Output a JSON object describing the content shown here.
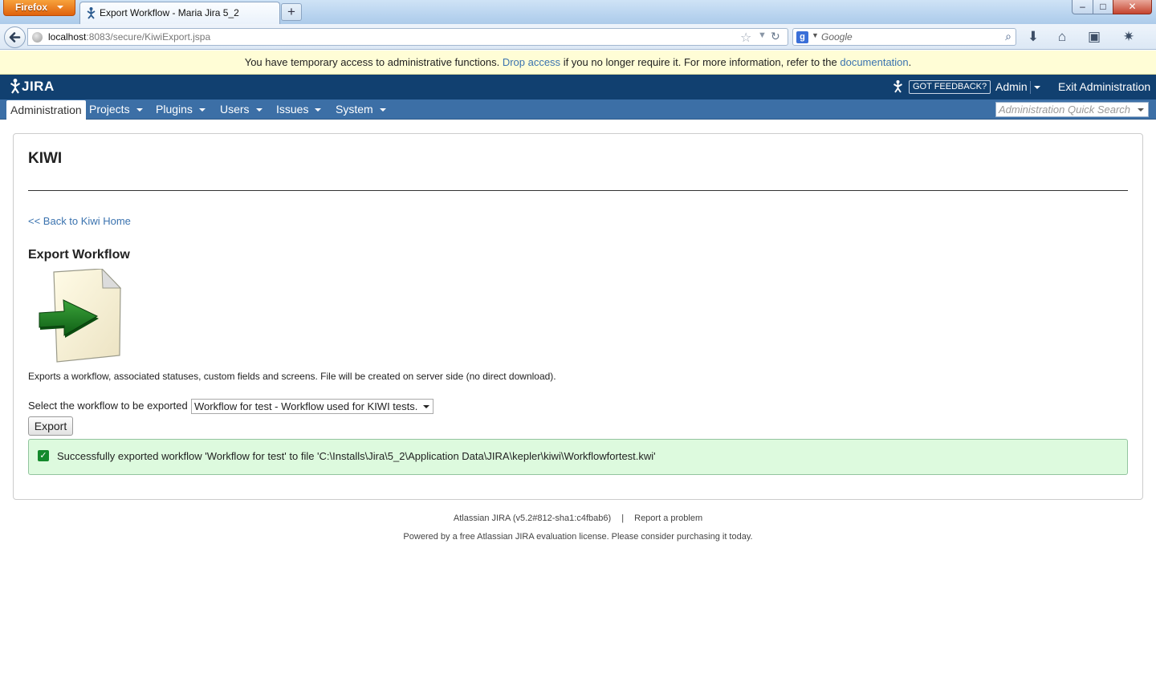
{
  "browser": {
    "menu_button": "Firefox",
    "tab_title": "Export Workflow - Maria Jira 5_2",
    "new_tab": "+",
    "url_host": "localhost",
    "url_rest": ":8083/secure/KiwiExport.jspa",
    "search_placeholder": "Google",
    "window_controls": {
      "minimize": "–",
      "maximize": "□",
      "close": "✕"
    },
    "toolbar_icons": [
      "download-icon",
      "home-icon",
      "bookmarks-icon",
      "addon-icon"
    ]
  },
  "notice": {
    "prefix": "You have temporary access to administrative functions.",
    "drop_access": "Drop access",
    "middle": "if you no longer require it. For more information, refer to the",
    "documentation": "documentation",
    "suffix": "."
  },
  "header": {
    "logo": "JIRA",
    "feedback": "GOT FEEDBACK?",
    "admin": "Admin",
    "exit": "Exit Administration"
  },
  "admin_nav": {
    "items": [
      "Administration",
      "Projects",
      "Plugins",
      "Users",
      "Issues",
      "System"
    ],
    "quick_search_placeholder": "Administration Quick Search"
  },
  "page": {
    "title": "KIWI",
    "back_link": "<< Back to Kiwi Home",
    "section_title": "Export Workflow",
    "description": "Exports a workflow, associated statuses, custom fields and screens. File will be created on server side (no direct download).",
    "select_label": "Select the workflow to be exported",
    "select_value": "Workflow for test - Workflow used for KIWI tests.",
    "export_button": "Export",
    "success_message": "Successfully exported workflow 'Workflow for test' to file 'C:\\Installs\\Jira\\5_2\\Application Data\\JIRA\\kepler\\kiwi\\Workflowfortest.kwi'"
  },
  "footer": {
    "version": "Atlassian JIRA (v5.2#812-sha1:c4fbab6)",
    "separator": "|",
    "report": "Report a problem",
    "license": "Powered by a free Atlassian JIRA evaluation license. Please consider purchasing it today."
  },
  "colors": {
    "header_bg": "#114070",
    "nav_bg": "#3c6fa6",
    "link": "#3b73af",
    "success_bg": "#ddfade",
    "notice_bg": "#fffdd6"
  }
}
